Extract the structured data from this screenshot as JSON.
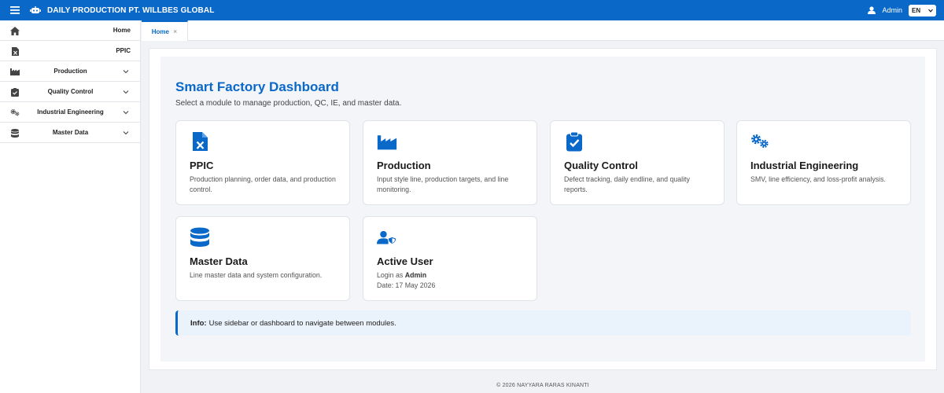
{
  "header": {
    "app_title": "DAILY PRODUCTION PT. WILLBES GLOBAL",
    "user_name": "Admin",
    "language": "EN",
    "menu_icon": "hamburger-menu-icon",
    "logo_icon": "robot-logo-icon"
  },
  "sidebar": {
    "items": [
      {
        "label": "Home",
        "icon": "home-icon",
        "expandable": false
      },
      {
        "label": "PPIC",
        "icon": "file-excel-icon",
        "expandable": false
      },
      {
        "label": "Production",
        "icon": "factory-icon",
        "expandable": true
      },
      {
        "label": "Quality Control",
        "icon": "clipboard-check-icon",
        "expandable": true
      },
      {
        "label": "Industrial Engineering",
        "icon": "gears-icon",
        "expandable": true
      },
      {
        "label": "Master Data",
        "icon": "database-icon",
        "expandable": true
      }
    ]
  },
  "tabs": [
    {
      "label": "Home",
      "close": "×",
      "active": true
    }
  ],
  "dashboard": {
    "title": "Smart Factory Dashboard",
    "subtitle": "Select a module to manage production, QC, IE, and master data.",
    "cards": [
      {
        "title": "PPIC",
        "description": "Production planning, order data, and production control.",
        "icon": "file-excel-icon"
      },
      {
        "title": "Production",
        "description": "Input style line, production targets, and line monitoring.",
        "icon": "factory-icon"
      },
      {
        "title": "Quality Control",
        "description": "Defect tracking, daily endline, and quality reports.",
        "icon": "clipboard-check-icon"
      },
      {
        "title": "Industrial Engineering",
        "description": "SMV, line efficiency, and loss-profit analysis.",
        "icon": "gears-icon"
      },
      {
        "title": "Master Data",
        "description": "Line master data and system configuration.",
        "icon": "database-icon"
      },
      {
        "title": "Active User",
        "login_prefix": "Login as",
        "login_user": "Admin",
        "date_line": "Date: 17 May 2026",
        "icon": "user-shield-icon"
      }
    ],
    "info": {
      "label": "Info:",
      "text": "Use sidebar or dashboard to navigate between modules."
    }
  },
  "footer": {
    "text": "© 2026 NAYYARA RARAS KINANTI"
  },
  "colors": {
    "primary": "#0a68c9",
    "background": "#f0f2f5",
    "card_bg": "#ffffff",
    "info_bg": "#eaf2fb"
  }
}
